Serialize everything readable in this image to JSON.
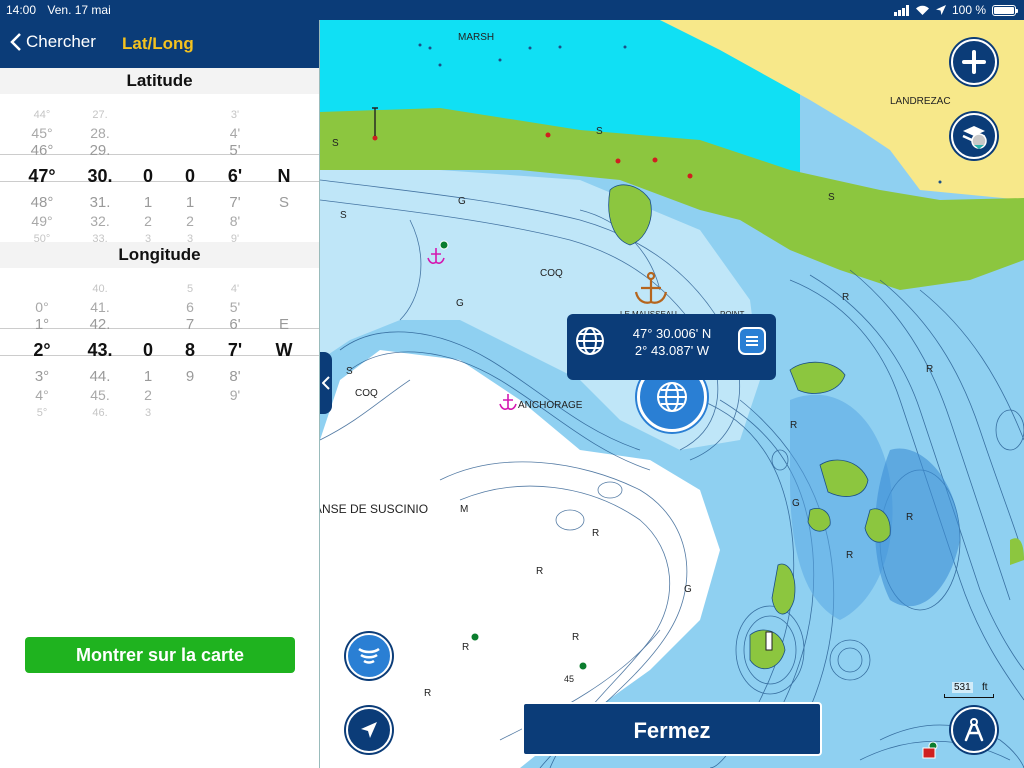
{
  "status_bar": {
    "time": "14:00",
    "date": "Ven. 17 mai",
    "battery": "100 %"
  },
  "nav": {
    "back_label": "Chercher",
    "title": "Lat/Long"
  },
  "latitude": {
    "title": "Latitude",
    "columns": [
      {
        "above": [
          "44°",
          "45°",
          "46°"
        ],
        "value": "47°",
        "below": [
          "48°",
          "49°",
          "50°"
        ]
      },
      {
        "above": [
          "27.",
          "28.",
          "29."
        ],
        "value": "30.",
        "below": [
          "31.",
          "32.",
          "33."
        ]
      },
      {
        "above": [
          "",
          "",
          ""
        ],
        "value": "0",
        "below": [
          "1",
          "2",
          "3"
        ]
      },
      {
        "above": [
          "",
          "",
          ""
        ],
        "value": "0",
        "below": [
          "1",
          "2",
          "3"
        ]
      },
      {
        "above": [
          "3'",
          "4'",
          "5'"
        ],
        "value": "6'",
        "below": [
          "7'",
          "8'",
          "9'"
        ]
      },
      {
        "above": [
          "",
          "",
          ""
        ],
        "value": "N",
        "below": [
          "S",
          "",
          ""
        ]
      }
    ]
  },
  "longitude": {
    "title": "Longitude",
    "columns": [
      {
        "above": [
          "",
          "0°",
          "1°"
        ],
        "value": "2°",
        "below": [
          "3°",
          "4°",
          "5°"
        ]
      },
      {
        "above": [
          "40.",
          "41.",
          "42."
        ],
        "value": "43.",
        "below": [
          "44.",
          "45.",
          "46."
        ]
      },
      {
        "above": [
          "",
          "",
          ""
        ],
        "value": "0",
        "below": [
          "1",
          "2",
          "3"
        ]
      },
      {
        "above": [
          "5",
          "6",
          "7"
        ],
        "value": "8",
        "below": [
          "9",
          "",
          ""
        ]
      },
      {
        "above": [
          "4'",
          "5'",
          "6'"
        ],
        "value": "7'",
        "below": [
          "8'",
          "9'",
          ""
        ]
      },
      {
        "above": [
          "",
          "",
          "E"
        ],
        "value": "W",
        "below": [
          "",
          "",
          ""
        ]
      }
    ]
  },
  "show_on_map_label": "Montrer sur la carte",
  "coordinate_popup": {
    "lat": "47° 30.006' N",
    "lon": "2° 43.087' W"
  },
  "close_label": "Fermez",
  "scale": {
    "value": "531",
    "unit": "ft"
  },
  "map_labels": [
    {
      "text": "MARSH"
    },
    {
      "text": "LANDREZAC"
    },
    {
      "text": "COQ"
    },
    {
      "text": "COQ"
    },
    {
      "text": "ANCHORAGE"
    },
    {
      "text": "ANSE DE SUSCINIO"
    },
    {
      "text": "LE MAUSSEAU"
    },
    {
      "text": "POINT"
    },
    {
      "text": "S"
    },
    {
      "text": "S"
    },
    {
      "text": "S"
    },
    {
      "text": "S"
    },
    {
      "text": "S"
    },
    {
      "text": "G"
    },
    {
      "text": "G"
    },
    {
      "text": "G"
    },
    {
      "text": "G"
    },
    {
      "text": "R"
    },
    {
      "text": "R"
    },
    {
      "text": "R"
    },
    {
      "text": "R"
    },
    {
      "text": "R"
    },
    {
      "text": "R"
    },
    {
      "text": "R"
    },
    {
      "text": "R"
    },
    {
      "text": "R"
    },
    {
      "text": "R"
    },
    {
      "text": "M"
    },
    {
      "text": "45"
    }
  ],
  "colors": {
    "nav_blue": "#0b3c78",
    "accent_yellow": "#f4c21f",
    "button_green": "#1fb31f",
    "land_green": "#8cc63f",
    "shallow_cyan": "#0fe3f5",
    "sand": "#f7e88a"
  }
}
